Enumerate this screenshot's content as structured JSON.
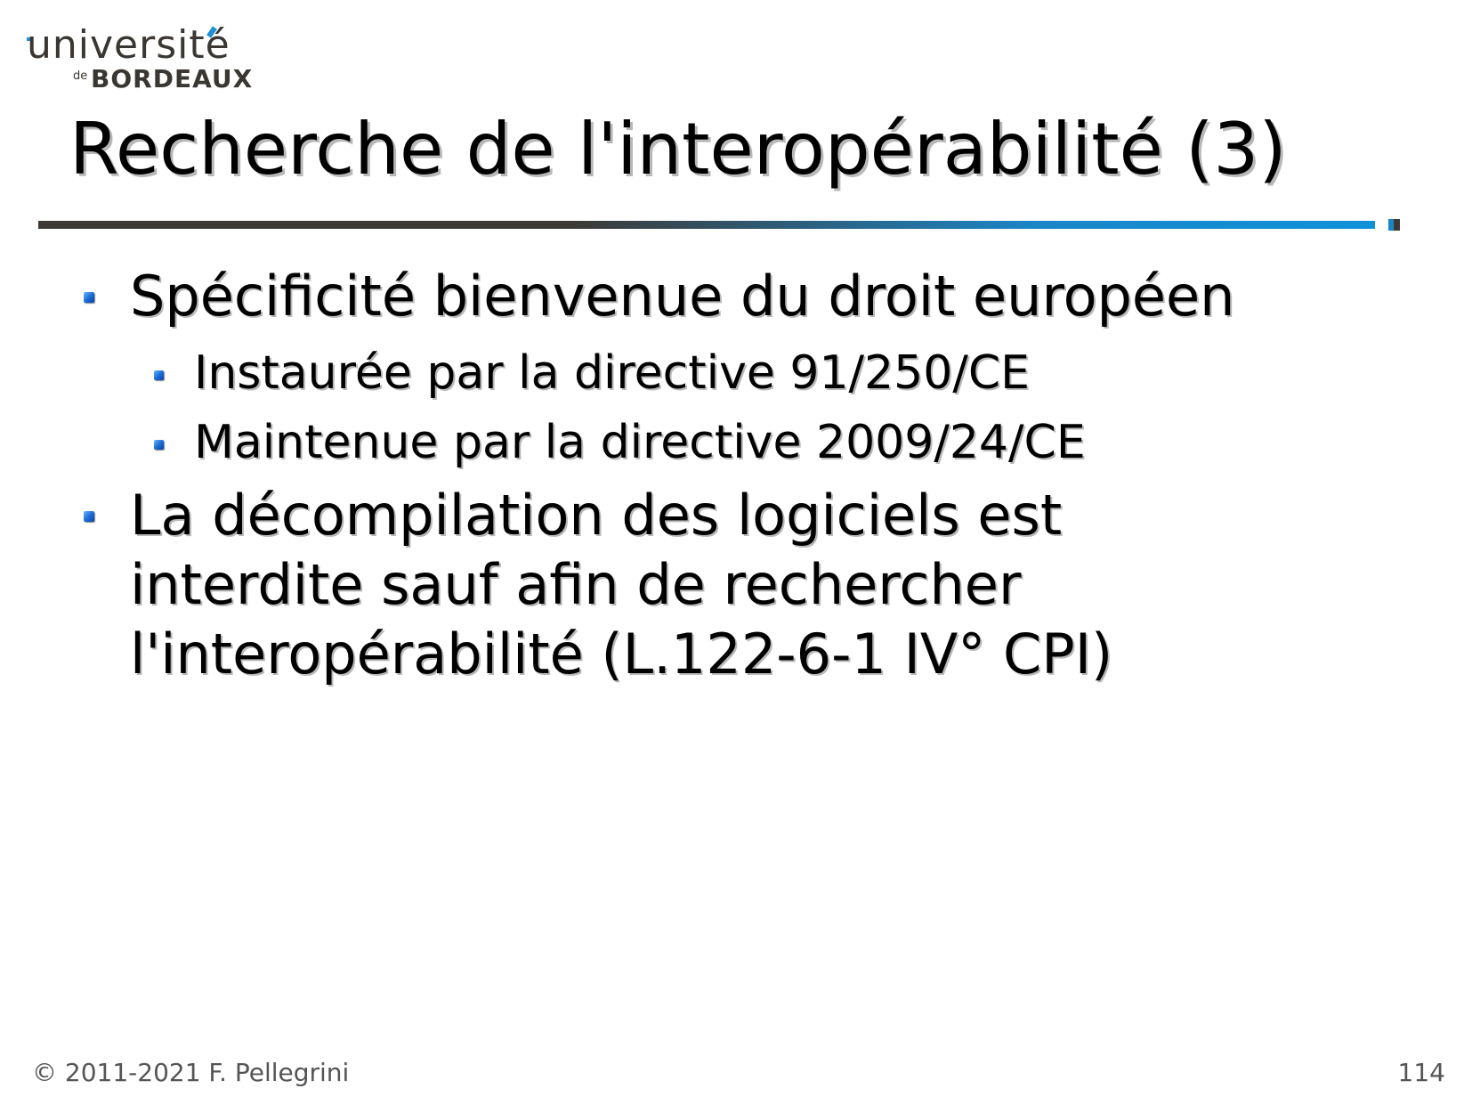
{
  "logo": {
    "line1": "université",
    "de": "de",
    "line2": "BORDEAUX"
  },
  "slide": {
    "title": "Recherche de l'interopérabilité (3)",
    "bullets": [
      {
        "text": "Spécificité bienvenue du droit européen"
      },
      {
        "text": "Instaurée par la directive 91/250/CE"
      },
      {
        "text": "Maintenue par la directive 2009/24/CE"
      },
      {
        "lines": [
          "La décompilation des logiciels est",
          "interdite sauf afin de rechercher",
          "l'interopérabilité (L.122-6-1 IV° CPI)"
        ]
      }
    ]
  },
  "footer": {
    "copyright": "© 2011-2021 F. Pellegrini",
    "page_number": "114"
  },
  "colors": {
    "rule_dark": "#3d3a36",
    "rule_blue": "#0f92d8",
    "bullet_blue": "#1c6fd6",
    "text": "#000000"
  }
}
